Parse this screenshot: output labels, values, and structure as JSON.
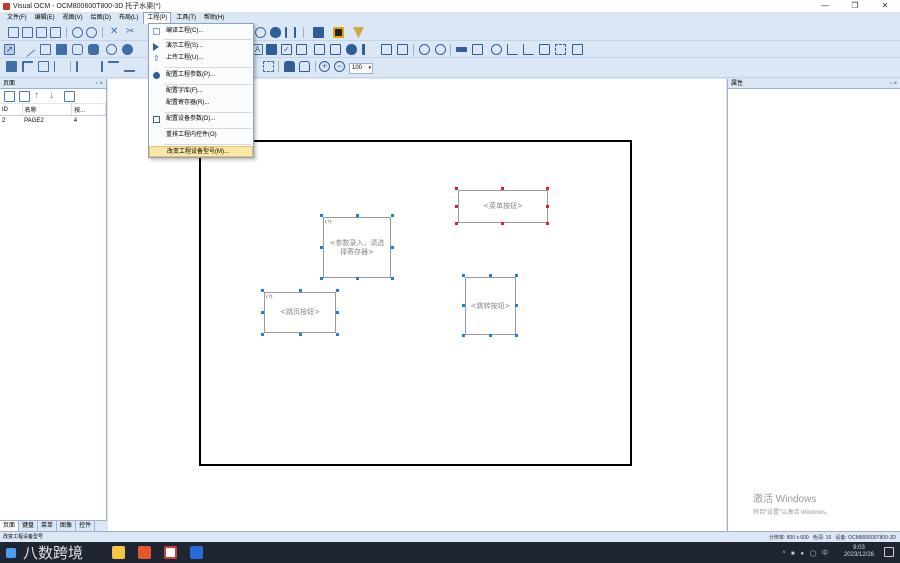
{
  "window": {
    "title": "Visual OCM - OCM800600T800-3D 托子水渠(*)",
    "min_label": "—",
    "max_label": "❐",
    "close_label": "✕"
  },
  "menubar": {
    "items": [
      {
        "label": "文件(F)"
      },
      {
        "label": "编辑(E)"
      },
      {
        "label": "视图(V)"
      },
      {
        "label": "绘图(D)"
      },
      {
        "label": "布局(L)"
      },
      {
        "label": "工程(P)"
      },
      {
        "label": "工具(T)"
      },
      {
        "label": "帮助(H)"
      }
    ]
  },
  "dropdown": {
    "items": [
      {
        "label": "编译工程(C)...",
        "icon": "compile-icon"
      },
      {
        "label": "演示工程(S)...",
        "icon": "play-icon"
      },
      {
        "label": "上传工程(U)...",
        "icon": "upload-icon"
      },
      {
        "label": "配置工程参数(P)...",
        "icon": "gear-icon"
      },
      {
        "label": "配置字库(F)...",
        "icon": "none"
      },
      {
        "label": "配置寄存器(R)...",
        "icon": "none"
      },
      {
        "label": "配置设备参数(D)...",
        "icon": "device-icon"
      },
      {
        "label": "重排工程内控件(O)",
        "icon": "none"
      },
      {
        "label": "改变工程设备型号(M)...",
        "icon": "none"
      }
    ]
  },
  "toolbar": {
    "zoom_value": "100"
  },
  "left_panel": {
    "header": "页面",
    "pin": "▫ ×",
    "columns": [
      "ID",
      "名称",
      "按..."
    ],
    "rows": [
      {
        "id": "2",
        "name": "PAGE2",
        "value": "4"
      }
    ],
    "tabs": [
      "页面",
      "键盘",
      "菜单",
      "图像",
      "控件"
    ]
  },
  "right_panel": {
    "header": "属性",
    "pin": "▫ ×"
  },
  "canvas": {
    "widgets": {
      "page_button": "<菜单按钮>",
      "numeric_input": "<参数录入，请选择寄存器>",
      "jump_button": "<跳页按钮>",
      "toggle_button": "<跳转按钮>"
    },
    "qmark": "(?)"
  },
  "watermark": {
    "line1": "激活 Windows",
    "line2": "转到\"设置\"以激活 Windows。"
  },
  "statusbar": {
    "left": "改变工程设备型号",
    "resolution": "分辨率: 800 x 600",
    "colors": "色深: 16",
    "device": "设备: OCM800600T800-3D"
  },
  "taskbar": {
    "brand": "八数跨境",
    "time": "9:03",
    "date": "2023/12/26",
    "tray": "^ ■ ● ◯ 中"
  },
  "colors": {
    "accent": "#dbe7f5",
    "selection_blue": "#1e7ee0",
    "selection_red": "#e02020",
    "highlight": "#fbe6a6"
  }
}
